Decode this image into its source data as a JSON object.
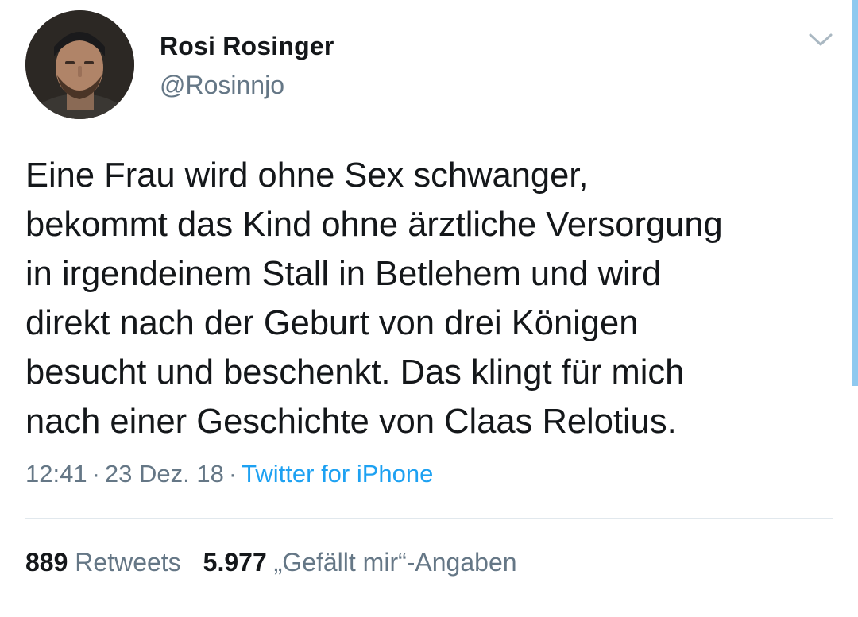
{
  "author": {
    "display_name": "Rosi Rosinger",
    "handle": "@Rosinnjo"
  },
  "tweet": {
    "text": "Eine Frau wird ohne Sex schwanger,\nbekommt das Kind ohne ärztliche Versorgung\nin irgendeinem Stall in Betlehem und wird\ndirekt nach der Geburt von drei Königen\nbesucht und beschenkt. Das klingt für mich\nnach einer Geschichte von Claas Relotius.",
    "time": "12:41",
    "separator": "·",
    "date": "23 Dez. 18",
    "source": "Twitter for iPhone"
  },
  "stats": {
    "retweets_count": "889",
    "retweets_label": "Retweets",
    "likes_count": "5.977",
    "likes_label": "„Gefällt mir“-Angaben"
  },
  "icons": {
    "menu": "chevron-down-icon"
  },
  "colors": {
    "text_primary": "#14171a",
    "text_secondary": "#657786",
    "link": "#1da1f2",
    "divider": "#e1e8ed",
    "scroll_indicator": "#8fc9ef"
  }
}
